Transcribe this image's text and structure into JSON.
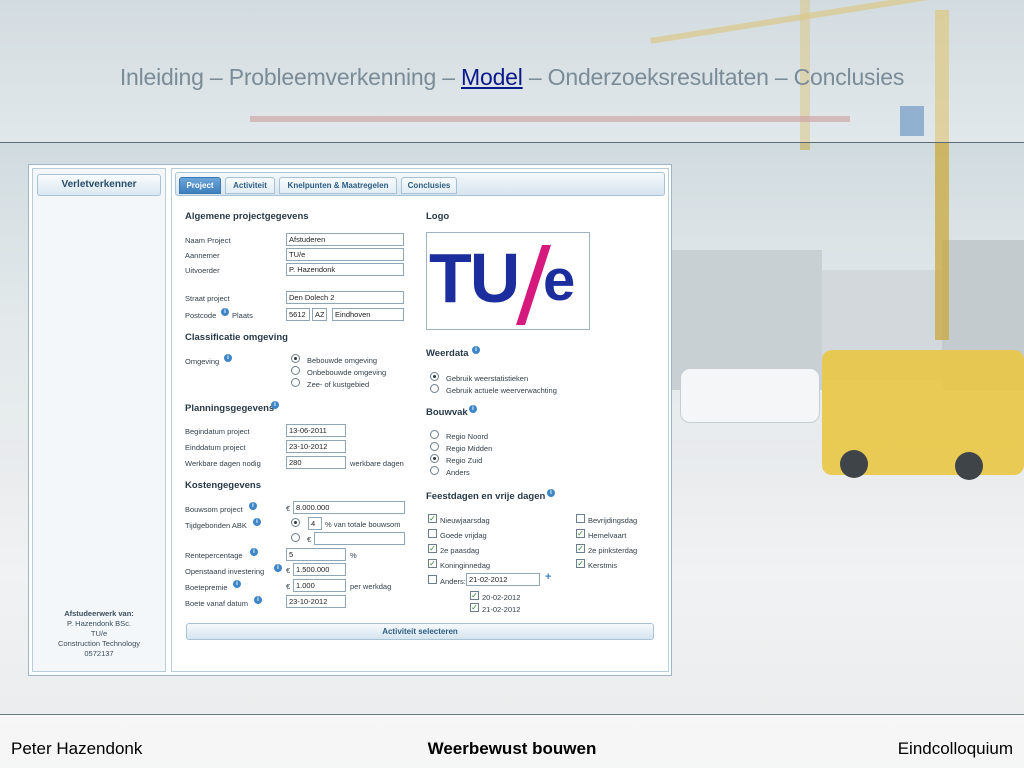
{
  "slide": {
    "title_parts": [
      "Inleiding – Probleemverkenning – ",
      "Model",
      " – Onderzoeksresultaten – Conclusies"
    ],
    "footer_left": "Peter Hazendonk",
    "footer_center": "Weerbewust bouwen",
    "footer_right": "Eindcolloquium"
  },
  "app": {
    "sidebar": {
      "title": "Verletverkenner",
      "info_heading": "Afstudeerwerk van:",
      "info_lines": [
        "P. Hazendonk BSc.",
        "TU/e",
        "Construction Technology",
        "0572137"
      ]
    },
    "tabs": [
      "Project",
      "Activiteit",
      "Knelpunten & Maatregelen",
      "Conclusies"
    ],
    "active_tab": "Project",
    "general": {
      "heading": "Algemene projectgegevens",
      "naam_label": "Naam Project",
      "naam_value": "Afstuderen",
      "aannemer_label": "Aannemer",
      "aannemer_value": "TU/e",
      "uitvoerder_label": "Uitvoerder",
      "uitvoerder_value": "P. Hazendonk",
      "straat_label": "Straat project",
      "straat_value": "Den Dolech 2",
      "postcode_label": "Postcode",
      "plaats_label": "Plaats",
      "postcode_num": "5612",
      "postcode_letters": "AZ",
      "plaats_value": "Eindhoven"
    },
    "classificatie": {
      "heading": "Classificatie omgeving",
      "omgeving_label": "Omgeving",
      "options": [
        "Bebouwde omgeving",
        "Onbebouwde omgeving",
        "Zee- of kustgebied"
      ],
      "selected": 0
    },
    "planning": {
      "heading": "Planningsgegevens",
      "begin_label": "Begindatum project",
      "begin_value": "13-06-2011",
      "eind_label": "Einddatum project",
      "eind_value": "23-10-2012",
      "werkbaar_label": "Werkbare dagen nodig",
      "werkbaar_value": "280",
      "werkbaar_unit": "werkbare dagen"
    },
    "kosten": {
      "heading": "Kostengegevens",
      "bouwsom_label": "Bouwsom project",
      "currency": "€",
      "bouwsom_value": "8.000.000",
      "tijd_label": "Tijdgebonden ABK",
      "tijd_value": "4",
      "tijd_unit": "% van totale bouwsom",
      "tijd_alt_value": "",
      "rente_label": "Rentepercentage",
      "rente_value": "5",
      "rente_unit": "%",
      "open_label": "Openstaand investering",
      "open_value": "1.500.000",
      "boete_label": "Boetepremie",
      "boete_value": "1.000",
      "boete_unit": "per werkdag",
      "boete_vanaf_label": "Boete vanaf datum",
      "boete_vanaf_value": "23-10-2012"
    },
    "logo": {
      "heading": "Logo",
      "tu": "TU",
      "e": "e"
    },
    "weerdata": {
      "heading": "Weerdata",
      "options": [
        "Gebruik weerstatistieken",
        "Gebruik actuele weerverwachting"
      ],
      "selected": 0
    },
    "bouwvak": {
      "heading": "Bouwvak",
      "options": [
        "Regio Noord",
        "Regio Midden",
        "Regio Zuid",
        "Anders"
      ],
      "selected": 2
    },
    "feestdagen": {
      "heading": "Feestdagen en vrije dagen",
      "left": [
        {
          "label": "Nieuwjaarsdag",
          "checked": true
        },
        {
          "label": "Goede vrijdag",
          "checked": false
        },
        {
          "label": "2e paasdag",
          "checked": true
        },
        {
          "label": "Koninginnedag",
          "checked": true
        }
      ],
      "right": [
        {
          "label": "Bevrijdingsdag",
          "checked": false
        },
        {
          "label": "Hemelvaart",
          "checked": true
        },
        {
          "label": "2e pinksterdag",
          "checked": true
        },
        {
          "label": "Kerstmis",
          "checked": true
        }
      ],
      "anders_label": "Anders:",
      "anders_value": "21-02-2012",
      "extra": [
        {
          "label": "20-02-2012",
          "checked": true
        },
        {
          "label": "21-02-2012",
          "checked": true
        }
      ]
    },
    "select_button": "Activiteit selecteren"
  }
}
